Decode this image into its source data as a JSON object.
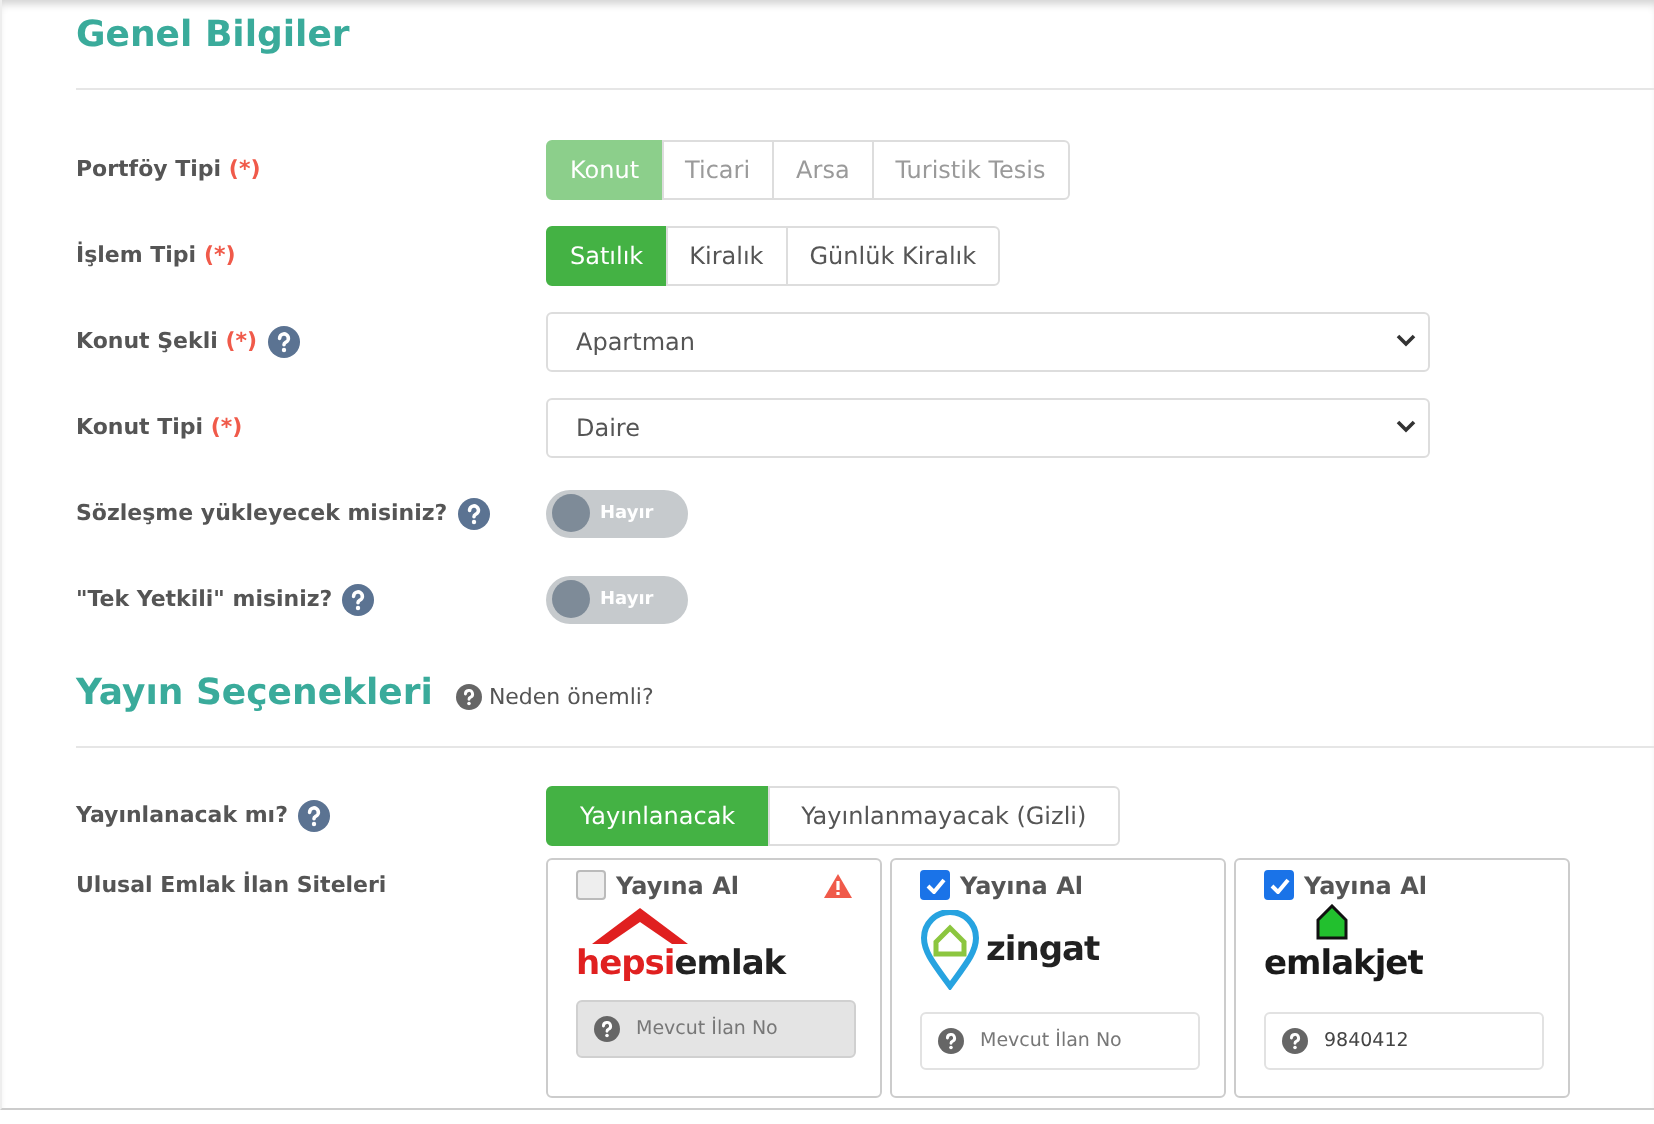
{
  "sections": [
    {
      "title": "Genel Bilgiler",
      "rows": [
        {
          "kind": "segmented",
          "label": "Portföy Tipi",
          "required": "(*)",
          "disabled": true,
          "options": [
            {
              "label": "Konut",
              "selected": true
            },
            {
              "label": "Ticari",
              "selected": false
            },
            {
              "label": "Arsa",
              "selected": false
            },
            {
              "label": "Turistik Tesis",
              "selected": false
            }
          ]
        },
        {
          "kind": "segmented",
          "label": "İşlem Tipi",
          "required": "(*)",
          "disabled": false,
          "options": [
            {
              "label": "Satılık",
              "selected": true
            },
            {
              "label": "Kiralık",
              "selected": false
            },
            {
              "label": "Günlük Kiralık",
              "selected": false
            }
          ]
        },
        {
          "kind": "select",
          "label": "Konut Şekli",
          "required": "(*)",
          "help": true,
          "value": "Apartman"
        },
        {
          "kind": "select",
          "label": "Konut Tipi",
          "required": "(*)",
          "value": "Daire"
        },
        {
          "kind": "toggle",
          "label": "Sözleşme yükleyecek misiniz?",
          "help": true,
          "on": false,
          "text": "Hayır"
        },
        {
          "kind": "toggle",
          "label": "\"Tek Yetkili\" misiniz?",
          "help": true,
          "on": false,
          "text": "Hayır"
        }
      ]
    },
    {
      "title": "Yayın Seçenekleri",
      "link": "Neden önemli?",
      "rows": [
        {
          "kind": "segmented",
          "label": "Yayınlanacak mı?",
          "help": true,
          "disabled": false,
          "wide": true,
          "options": [
            {
              "label": "Yayınlanacak",
              "selected": true
            },
            {
              "label": "Yayınlanmayacak (Gizli)",
              "selected": false
            }
          ]
        },
        {
          "kind": "sites",
          "label": "Ulusal Emlak İlan Siteleri",
          "sites": [
            {
              "check_label": "Yayına Al",
              "checked": false,
              "warning": true,
              "kind": "house",
              "logo_parts": [
                {
                  "text": "hepsi",
                  "color": "#e02020"
                },
                {
                  "text": "emlak",
                  "color": "#222222"
                }
              ],
              "field": {
                "placeholder": "Mevcut İlan No",
                "disabled": true
              }
            },
            {
              "check_label": "Yayına Al",
              "checked": true,
              "warning": false,
              "kind": "pin",
              "logo_parts": [
                {
                  "text": "zingat",
                  "color": "#222222"
                }
              ],
              "field": {
                "placeholder": "Mevcut İlan No",
                "disabled": false
              }
            },
            {
              "check_label": "Yayına Al",
              "checked": true,
              "warning": false,
              "kind": "greenhouse",
              "logo_parts": [
                {
                  "text": "emlakjet",
                  "color": "#1a1a1a"
                }
              ],
              "field": {
                "value": "9840412",
                "disabled": false
              }
            }
          ]
        }
      ]
    }
  ]
}
